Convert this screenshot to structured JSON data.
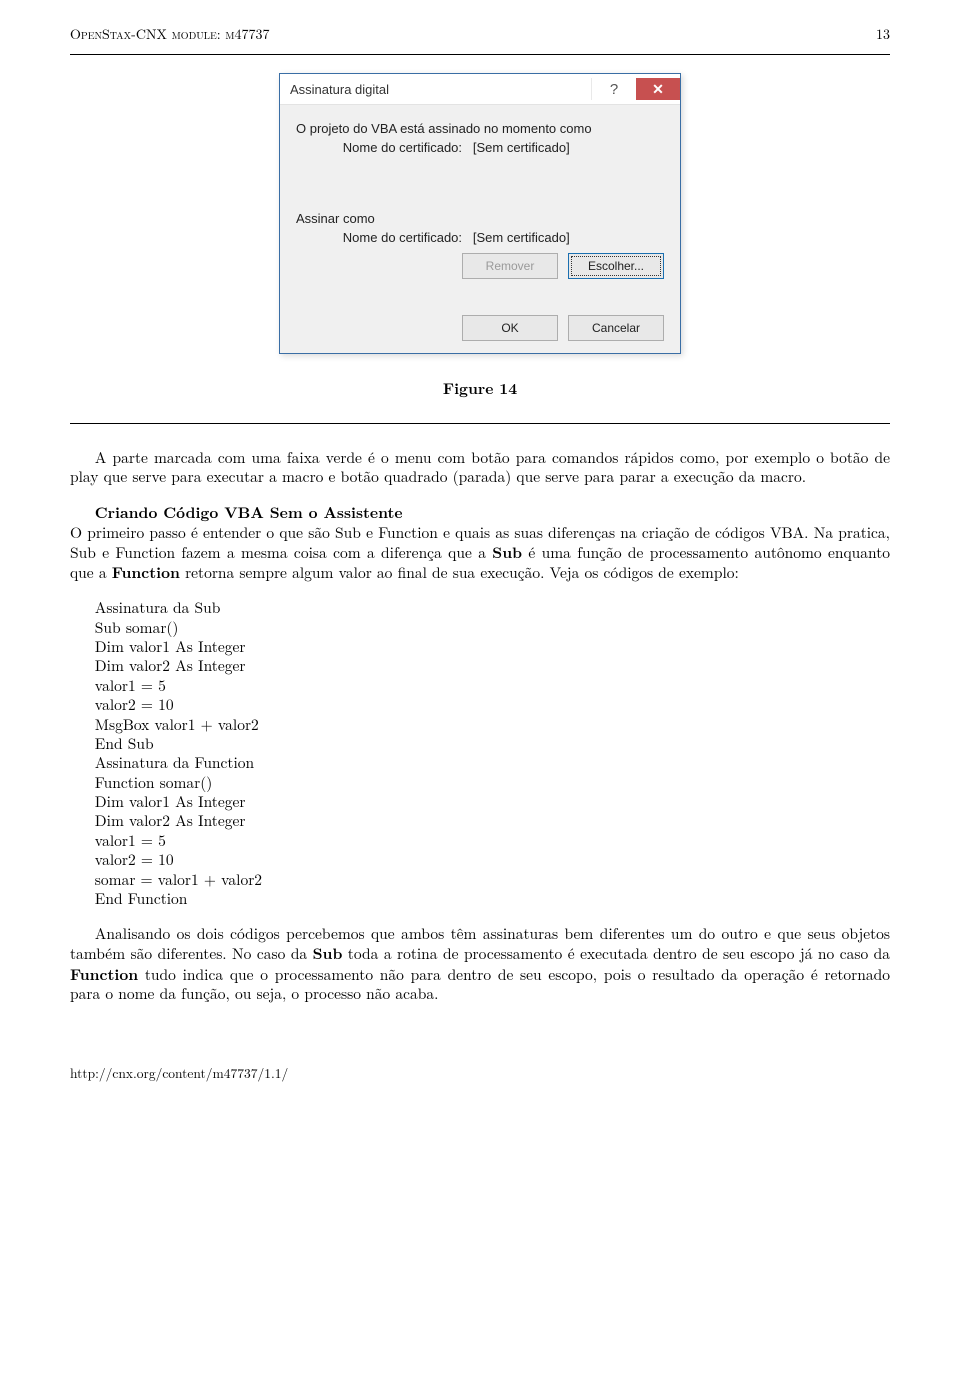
{
  "header": {
    "module": "OpenStax-CNX module: m47737",
    "page_number": "13"
  },
  "dialog": {
    "title": "Assinatura digital",
    "help_symbol": "?",
    "close_symbol": "✕",
    "line1": "O projeto do VBA está assinado no momento como",
    "cert_label": "Nome do certificado:",
    "cert_value_none": "[Sem certificado]",
    "sign_as_label": "Assinar como",
    "buttons": {
      "remove": "Remover",
      "choose": "Escolher...",
      "ok": "OK",
      "cancel": "Cancelar"
    }
  },
  "figure": {
    "caption_label": "Figure 14"
  },
  "body": {
    "p1": "A parte marcada com uma faixa verde é o menu com botão para comandos rápidos como, por exemplo o botão de play que serve para executar a macro e botão quadrado (parada) que serve para parar a execução da macro.",
    "section_title": "Criando Código VBA Sem o Assistente",
    "p2": "O primeiro passo é entender o que são Sub e Function e quais as suas diferenças na criação de códigos VBA. Na pratica, Sub e Function fazem a mesma coisa com a diferença que a ",
    "p2_b1": "Sub",
    "p2_c1": " é uma função de processamento autônomo enquanto que a ",
    "p2_b2": "Function",
    "p2_c2": " retorna sempre algum valor ao final de sua execução. Veja os códigos de exemplo:",
    "code1_title": "Assinatura da Sub",
    "code1_l1": "Sub somar()",
    "code1_l2": "Dim valor1 As Integer",
    "code1_l3": "Dim valor2 As Integer",
    "code1_l4": "valor1 = 5",
    "code1_l5": "valor2 = 10",
    "code1_l6": "MsgBox valor1 + valor2",
    "code1_l7": "End Sub",
    "code2_title": "Assinatura da Function",
    "code2_l1": "Function somar()",
    "code2_l2": "Dim valor1 As Integer",
    "code2_l3": "Dim valor2 As Integer",
    "code2_l4": "valor1 = 5",
    "code2_l5": "valor2 = 10",
    "code2_l6": "somar = valor1 + valor2",
    "code2_l7": "End Function",
    "p3_a": "Analisando os dois códigos percebemos que ambos têm assinaturas bem diferentes um do outro e que seus objetos também são diferentes. No caso da ",
    "p3_b1": "Sub",
    "p3_b": " toda a rotina de processamento é executada dentro de seu escopo já no caso da ",
    "p3_b2": "Function",
    "p3_c": " tudo indica que o processamento não para dentro de seu escopo, pois o resultado da operação é retornado para o nome da função, ou seja, o processo não acaba."
  },
  "footer": {
    "url": "http://cnx.org/content/m47737/1.1/"
  }
}
